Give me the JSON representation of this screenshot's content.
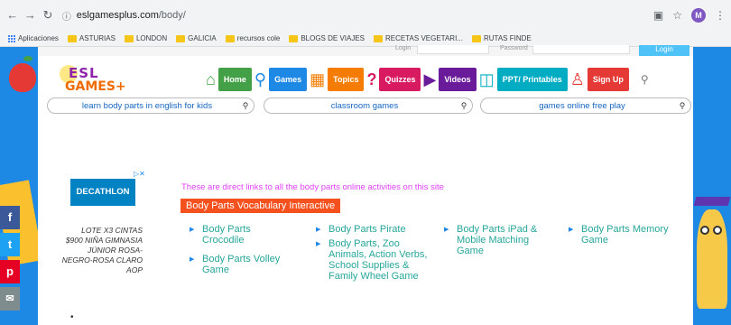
{
  "browser": {
    "url_host": "eslgamesplus.com",
    "url_path": "/body/",
    "profile_initial": "M"
  },
  "bookmarks": [
    {
      "label": "Aplicaciones",
      "icon": "apps-icon"
    },
    {
      "label": "ASTURIAS",
      "icon": "folder-icon"
    },
    {
      "label": "LONDON",
      "icon": "folder-icon"
    },
    {
      "label": "GALICIA",
      "icon": "folder-icon"
    },
    {
      "label": "recursos cole",
      "icon": "folder-icon"
    },
    {
      "label": "BLOGS DE VIAJES",
      "icon": "folder-icon"
    },
    {
      "label": "RECETAS VEGETARI...",
      "icon": "folder-icon"
    },
    {
      "label": "RUTAS FINDE",
      "icon": "folder-icon"
    }
  ],
  "header": {
    "login_label": "Login",
    "password_label": "Password",
    "login_button": "Login"
  },
  "logo": {
    "line1": "ESL",
    "line2": "GAMES+"
  },
  "nav": {
    "home": "Home",
    "games": "Games",
    "topics": "Topics",
    "quizzes": "Quizzes",
    "videos": "Videos",
    "ppt": "PPT/ Printables",
    "signup": "Sign Up"
  },
  "search_bars": [
    "learn body parts in english for kids",
    "classroom games",
    "games online free play"
  ],
  "ad": {
    "brand": "DECATHLON",
    "text": "LOTE X3 CINTAS\n$900 NIÑA GIMNASIA\nJÚNIOR ROSA-\nNEGRO-ROSA CLARO\nAOP",
    "bullet": "•"
  },
  "content": {
    "intro": "These are direct links to all the body parts online activities on this site",
    "section_title": "Body Parts Vocabulary Interactive",
    "links": [
      [
        "Body Parts Crocodile",
        "Body Parts Volley Game"
      ],
      [
        "Body Parts Pirate",
        "Body Parts, Zoo Animals, Action Verbs, School Supplies & Family Wheel Game"
      ],
      [
        "Body Parts iPad & Mobile Matching Game"
      ],
      [
        "Body Parts Memory Game"
      ]
    ]
  },
  "social": {
    "facebook": "f",
    "twitter": "t",
    "pinterest": "p",
    "email": "✉"
  },
  "colors": {
    "sidebar": "#1e88e5",
    "link": "#26a69a",
    "intro": "#e040fb",
    "section": "#f4511e"
  }
}
